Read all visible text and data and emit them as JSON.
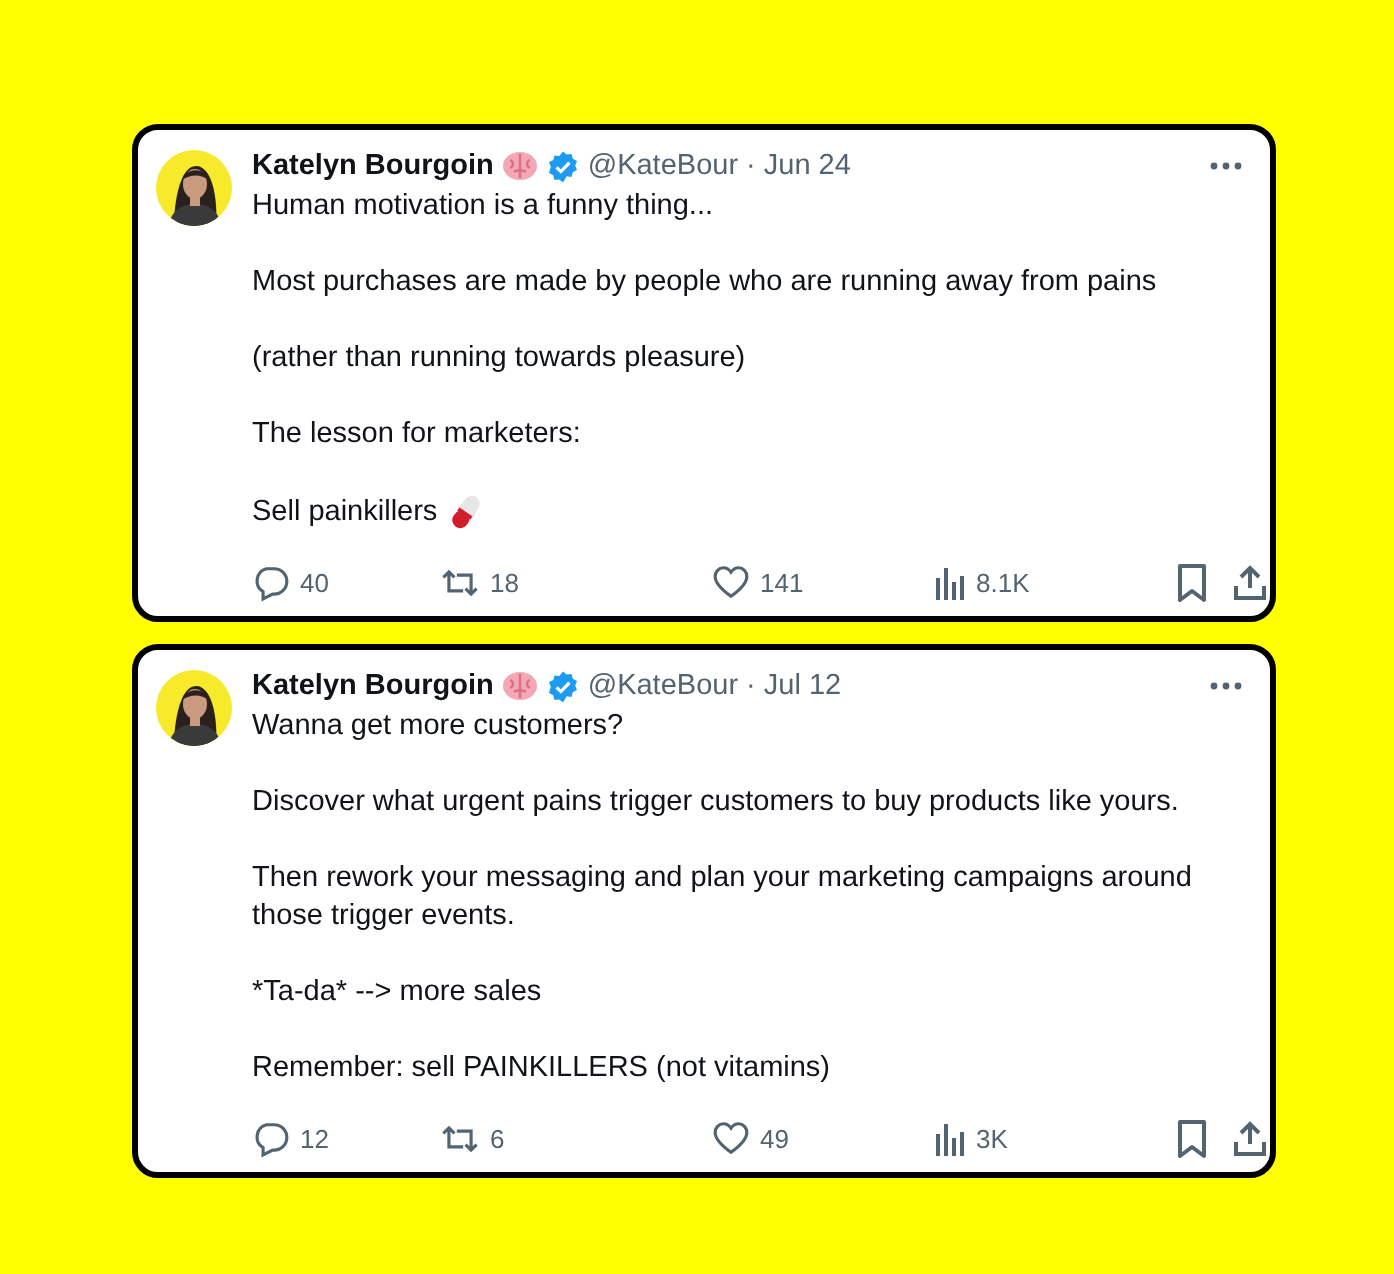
{
  "tweets": [
    {
      "author": "Katelyn Bourgoin",
      "handle": "@KateBour",
      "separator": "·",
      "date": "Jun 24",
      "verified": true,
      "paragraphs": [
        "Human motivation is a funny thing...",
        "Most purchases are made by people who are running away from pains",
        "(rather than running towards pleasure)",
        "The lesson for marketers:",
        "Sell painkillers"
      ],
      "replies": "40",
      "reposts": "18",
      "likes": "141",
      "views": "8.1K"
    },
    {
      "author": "Katelyn Bourgoin",
      "handle": "@KateBour",
      "separator": "·",
      "date": "Jul 12",
      "verified": true,
      "paragraphs": [
        "Wanna get more customers?",
        "Discover what urgent pains trigger customers to buy products like yours.",
        "Then rework your messaging and plan your marketing campaigns around those trigger events.",
        "*Ta-da* --> more sales",
        "Remember: sell PAINKILLERS (not vitamins)"
      ],
      "replies": "12",
      "reposts": "6",
      "likes": "49",
      "views": "3K"
    }
  ]
}
